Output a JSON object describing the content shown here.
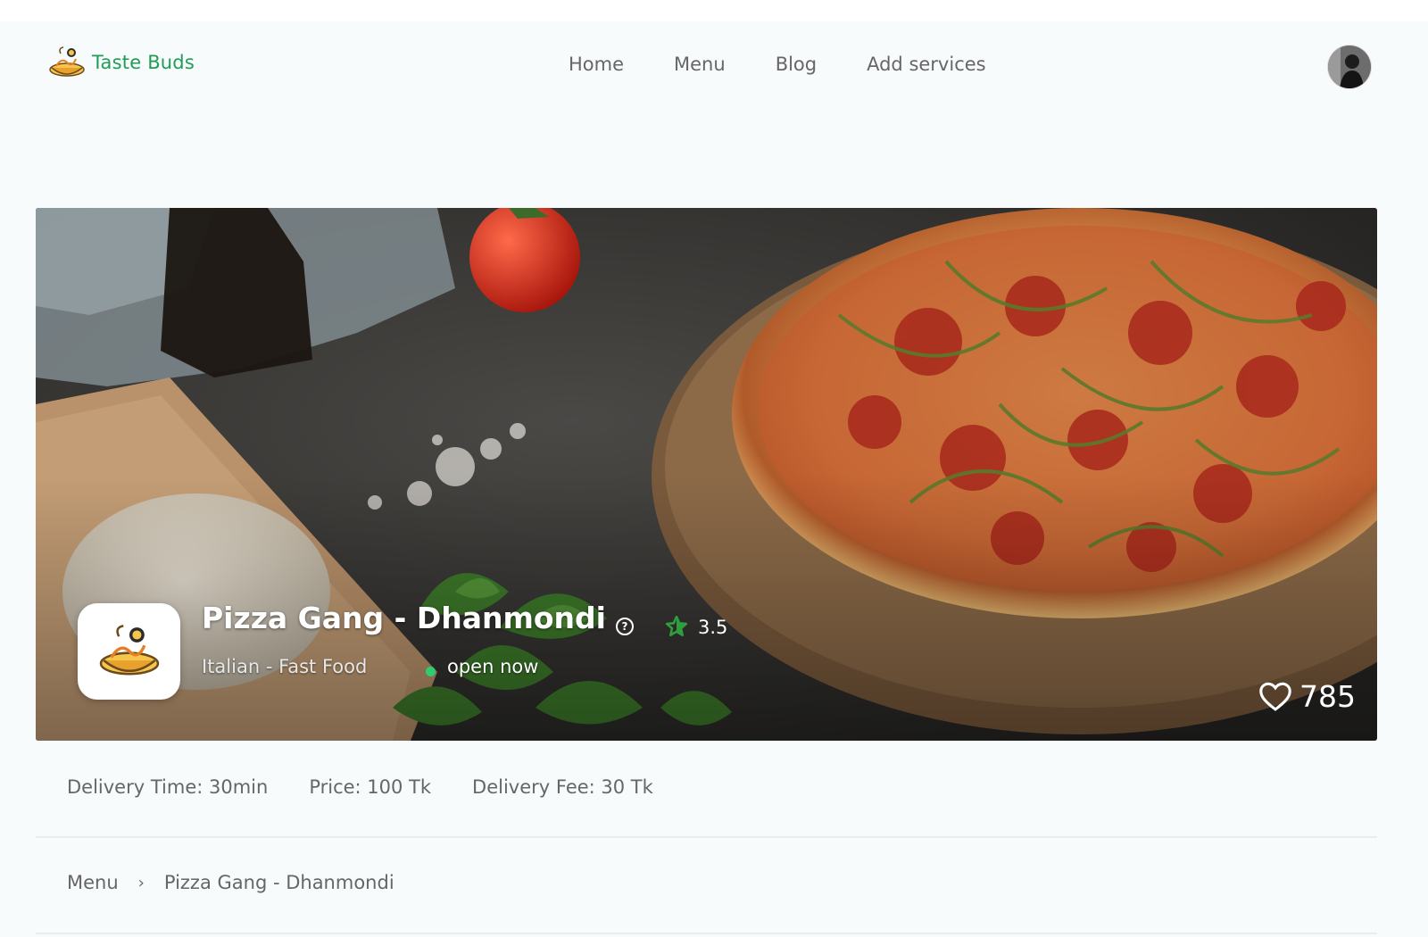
{
  "brand": {
    "name": "Taste Buds",
    "icon": "noodle-bowl-logo-icon"
  },
  "nav": {
    "items": [
      {
        "label": "Home"
      },
      {
        "label": "Menu"
      },
      {
        "label": "Blog"
      },
      {
        "label": "Add services"
      }
    ]
  },
  "user": {
    "avatar": "user-avatar"
  },
  "restaurant": {
    "name": "Pizza Gang - Dhanmondi",
    "cuisine": "Italian - Fast Food",
    "status": "open now",
    "rating": "3.5",
    "likes": "785",
    "help_icon_glyph": "?",
    "colors": {
      "brand_green": "#1f9d55",
      "status_green": "#2ecc71",
      "star_green": "#2e9e3e"
    }
  },
  "info": {
    "delivery_time": "Delivery Time: 30min",
    "price": "Price: 100 Tk",
    "delivery_fee": "Delivery Fee: 30 Tk"
  },
  "breadcrumb": {
    "items": [
      "Menu",
      "Pizza Gang - Dhanmondi"
    ],
    "separator": "›"
  }
}
